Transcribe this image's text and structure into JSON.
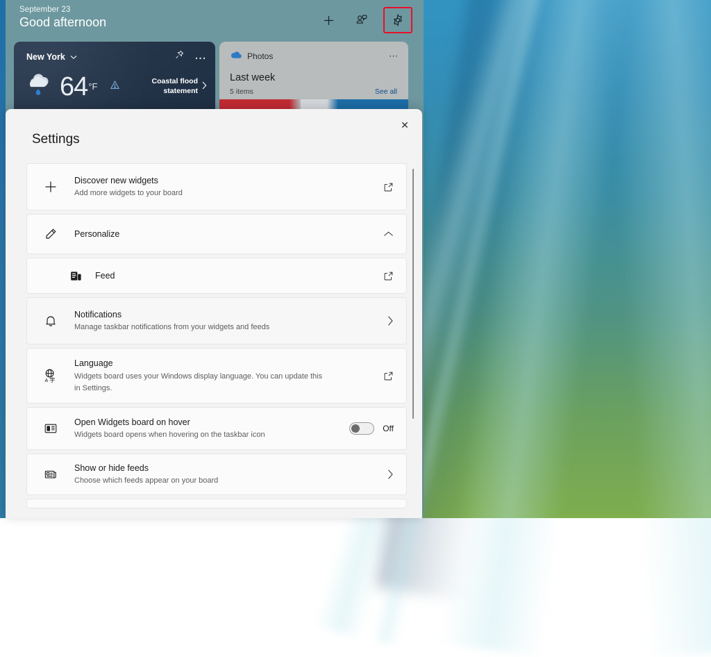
{
  "board": {
    "date": "September 23",
    "greeting": "Good afternoon",
    "actions": [
      {
        "name": "add-widget-button",
        "label": "+"
      },
      {
        "name": "notifications-button",
        "label": ""
      },
      {
        "name": "settings-gear-button",
        "label": ""
      }
    ],
    "weather": {
      "city": "New York",
      "temperature": "64",
      "unit": "°F",
      "alert": "Coastal flood statement",
      "chevron": "˅",
      "pin_icon": "pin-icon",
      "more_icon": "more-icon"
    },
    "photos": {
      "app": "Photos",
      "title": "Last week",
      "subtitle": "5 items",
      "action": "See all",
      "more_icon": "more-icon"
    }
  },
  "settings": {
    "title": "Settings",
    "close_label": "✕",
    "rows": [
      {
        "key": "discover",
        "icon": "plus-icon",
        "title": "Discover new widgets",
        "subtitle": "Add more widgets to your board",
        "affordance": "open-external-icon"
      },
      {
        "key": "personalize",
        "icon": "pencil-icon",
        "title": "Personalize",
        "subtitle": "",
        "affordance": "chevron-up-icon"
      },
      {
        "key": "feed",
        "icon": "feed-icon",
        "title": "Feed",
        "subtitle": "",
        "affordance": "open-external-icon"
      },
      {
        "key": "notifications",
        "icon": "bell-icon",
        "title": "Notifications",
        "subtitle": "Manage taskbar notifications from your widgets and feeds",
        "affordance": "chevron-right-icon"
      },
      {
        "key": "language",
        "icon": "language-globe-icon",
        "title": "Language",
        "subtitle": "Widgets board uses your Windows display language. You can update this in Settings.",
        "affordance": "open-external-icon"
      },
      {
        "key": "hover",
        "icon": "widgets-board-icon",
        "title": "Open Widgets board on hover",
        "subtitle": "Widgets board opens when hovering on the taskbar icon",
        "affordance": "toggle",
        "toggle_state": "Off"
      },
      {
        "key": "feeds",
        "icon": "newspaper-icon",
        "title": "Show or hide feeds",
        "subtitle": "Choose which feeds appear on your board",
        "affordance": "chevron-right-icon",
        "highlighted": true
      }
    ]
  },
  "colors": {
    "highlight_red": "#e8102a",
    "panel_bg": "#f3f3f3",
    "row_bg": "#fbfbfb",
    "link_blue": "#0b4d8f",
    "accent_blue": "#1e6fa8"
  }
}
